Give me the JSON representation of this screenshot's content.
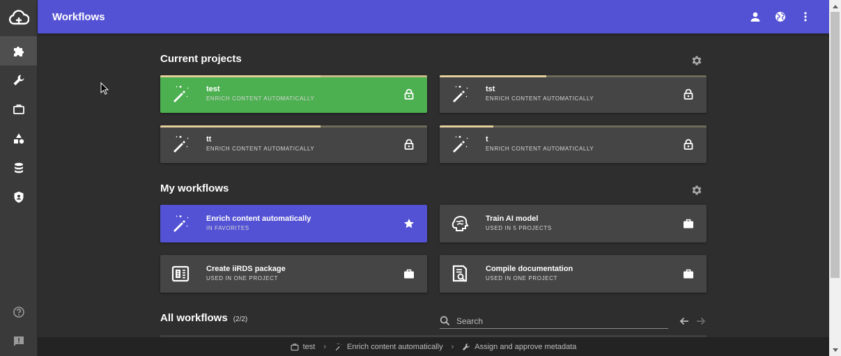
{
  "topbar": {
    "title": "Workflows"
  },
  "current_projects": {
    "title": "Current projects",
    "cards": [
      {
        "title": "test",
        "subtitle": "Enrich content automatically",
        "progress": 0.6,
        "active": true
      },
      {
        "title": "tst",
        "subtitle": "Enrich content automatically",
        "progress": 0.4,
        "active": false
      },
      {
        "title": "tt",
        "subtitle": "Enrich content automatically",
        "progress": 0.6,
        "active": false
      },
      {
        "title": "t",
        "subtitle": "Enrich content automatically",
        "progress": 0.2,
        "active": false
      }
    ]
  },
  "my_workflows": {
    "title": "My workflows",
    "cards": [
      {
        "title": "Enrich content automatically",
        "subtitle": "In favorites",
        "icon": "magic-wand-icon",
        "action": "star-icon"
      },
      {
        "title": "Train AI model",
        "subtitle": "Used in 5 projects",
        "icon": "brain-icon",
        "action": "briefcase-icon"
      },
      {
        "title": "Create iiRDS package",
        "subtitle": "Used in one project",
        "icon": "package-icon",
        "action": "briefcase-icon"
      },
      {
        "title": "Compile documentation",
        "subtitle": "Used in one project",
        "icon": "document-search-icon",
        "action": "briefcase-icon"
      }
    ]
  },
  "all_workflows": {
    "title": "All workflows",
    "count": "(2/2)"
  },
  "search": {
    "placeholder": "Search"
  },
  "breadcrumb": [
    {
      "label": "test",
      "icon": "briefcase-icon"
    },
    {
      "label": "Enrich content automatically",
      "icon": "magic-wand-icon"
    },
    {
      "label": "Assign and approve metadata",
      "icon": "wrench-icon"
    }
  ],
  "colors": {
    "topbar": "#5452d4",
    "active_project": "#4caf50",
    "favorite": "#5452d4",
    "card": "#454545",
    "background": "#2e2e2e"
  }
}
